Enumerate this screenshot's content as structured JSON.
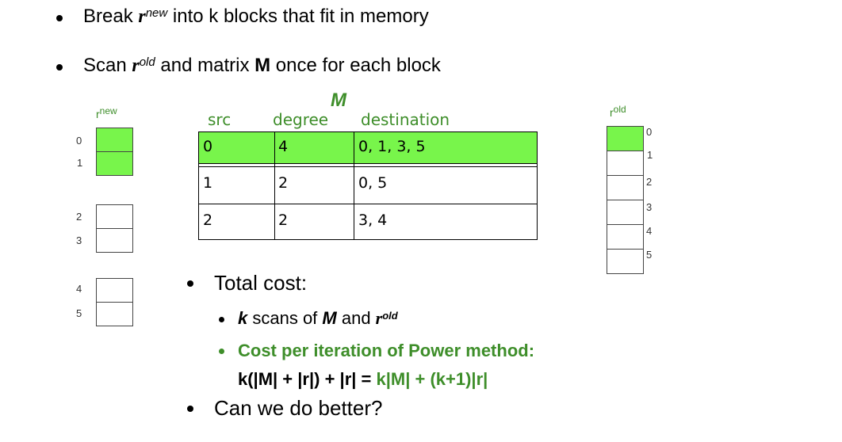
{
  "bullets": {
    "b1_pre": "Break ",
    "b1_r": "r",
    "b1_sup": "new",
    "b1_post": " into k blocks that fit in memory",
    "b2_pre": "Scan ",
    "b2_r": "r",
    "b2_sup": "old",
    "b2_mid": " and matrix ",
    "b2_M": "M",
    "b2_post": " once for each block"
  },
  "rnew": {
    "label_r": "r",
    "label_sup": "new",
    "indices": [
      "0",
      "1",
      "2",
      "3",
      "4",
      "5"
    ]
  },
  "rold": {
    "label_r": "r",
    "label_sup": "old",
    "indices": [
      "0",
      "1",
      "2",
      "3",
      "4",
      "5"
    ]
  },
  "matrix": {
    "title": "M",
    "headers": [
      "src",
      "degree",
      "destination"
    ],
    "rows": [
      {
        "src": "0",
        "degree": "4",
        "destination": "0, 1, 3, 5",
        "highlight": true
      },
      {
        "src": "1",
        "degree": "2",
        "destination": "0, 5",
        "highlight": false
      },
      {
        "src": "2",
        "degree": "2",
        "destination": "3, 4",
        "highlight": false
      }
    ]
  },
  "cost": {
    "heading": "Total cost:",
    "sub1_k": "k",
    "sub1_mid": " scans of ",
    "sub1_M": "M",
    "sub1_and": " and ",
    "sub1_r": "r",
    "sub1_sup": "old",
    "sub2_green": "Cost per iteration of Power method:",
    "formula_black": "k(|M| + |r|) + |r| = ",
    "formula_green": "k|M| + (k+1)|r|",
    "last": "Can we do better?"
  },
  "colors": {
    "accent_green": "#3e8e2a",
    "fill_green": "#78f54b"
  }
}
